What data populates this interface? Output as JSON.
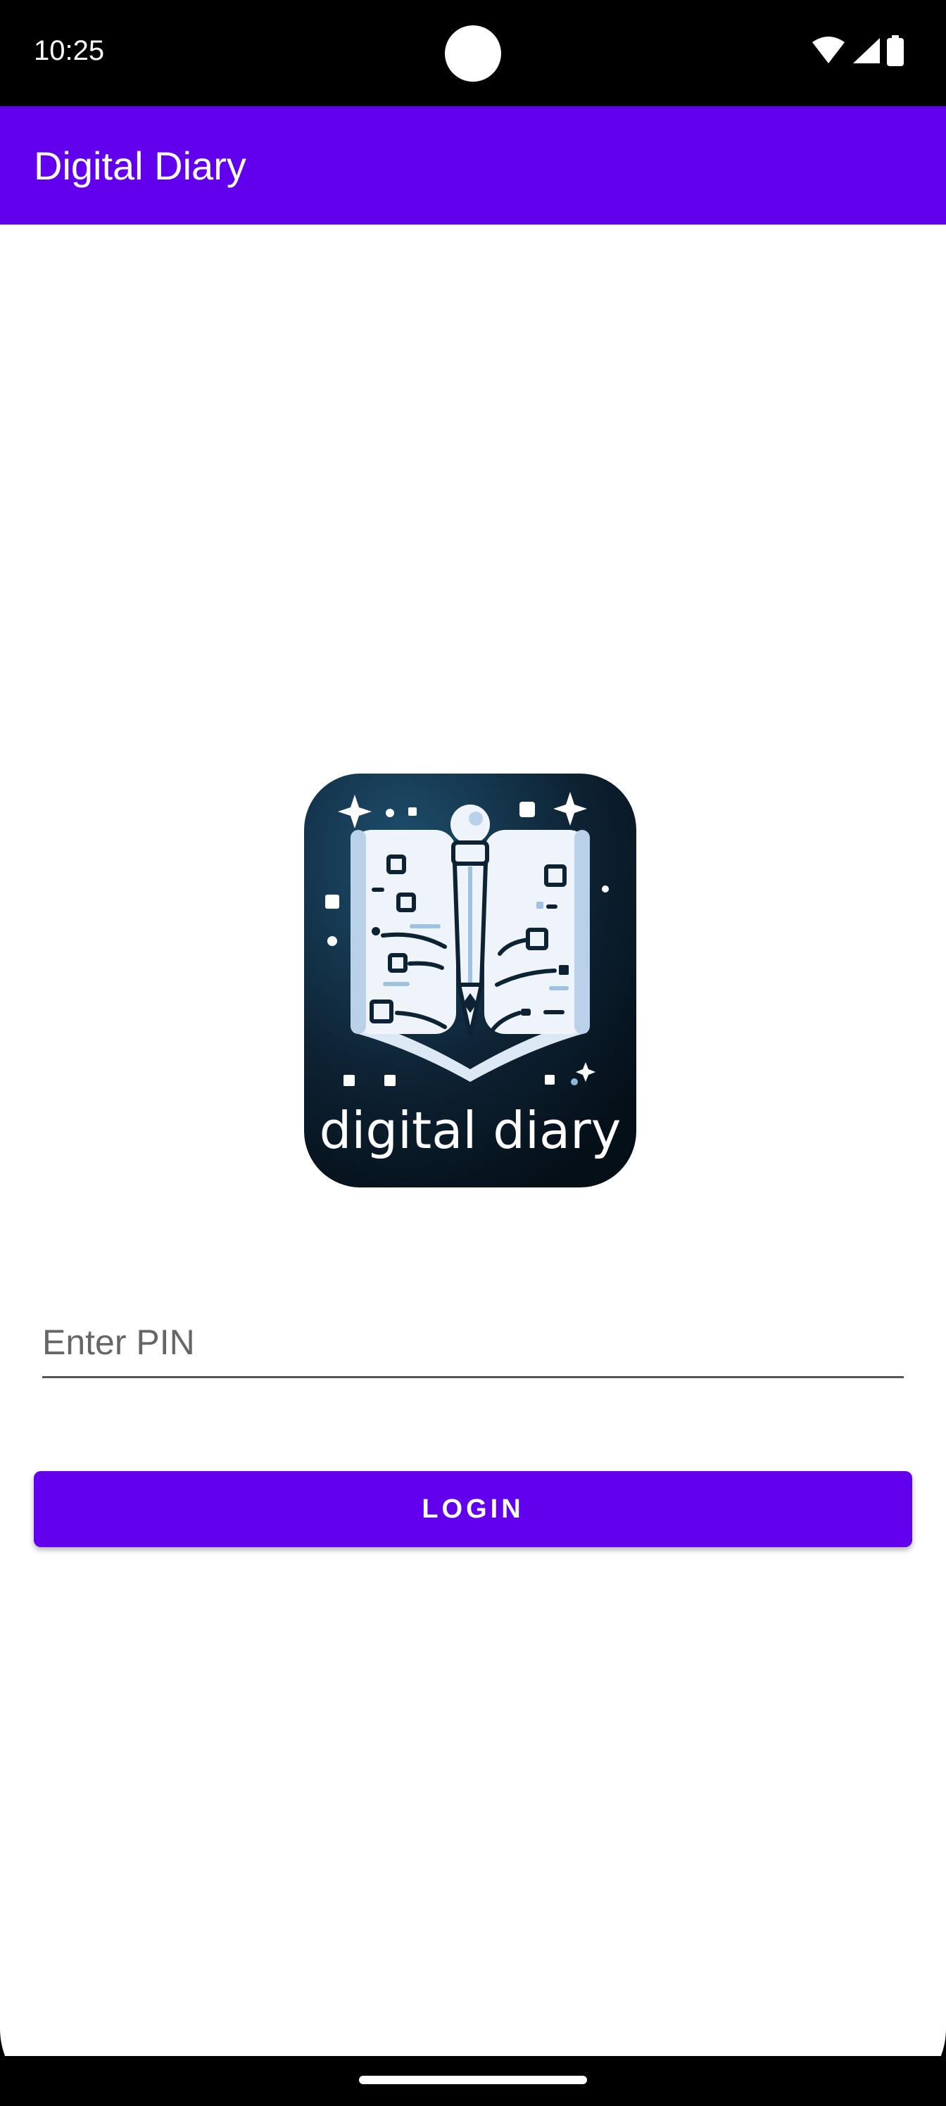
{
  "status_bar": {
    "time": "10:25",
    "icons": [
      "wifi-icon",
      "signal-icon",
      "battery-icon"
    ]
  },
  "app_bar": {
    "title": "Digital Diary"
  },
  "logo": {
    "icon": "digital-diary-logo",
    "text": "digital diary"
  },
  "login": {
    "pin_placeholder": "Enter PIN",
    "pin_value": "",
    "button_label": "LOGIN"
  },
  "colors": {
    "primary": "#6200ee",
    "background": "#ffffff",
    "logo_background": "#0d2233",
    "status_bar": "#000000"
  }
}
